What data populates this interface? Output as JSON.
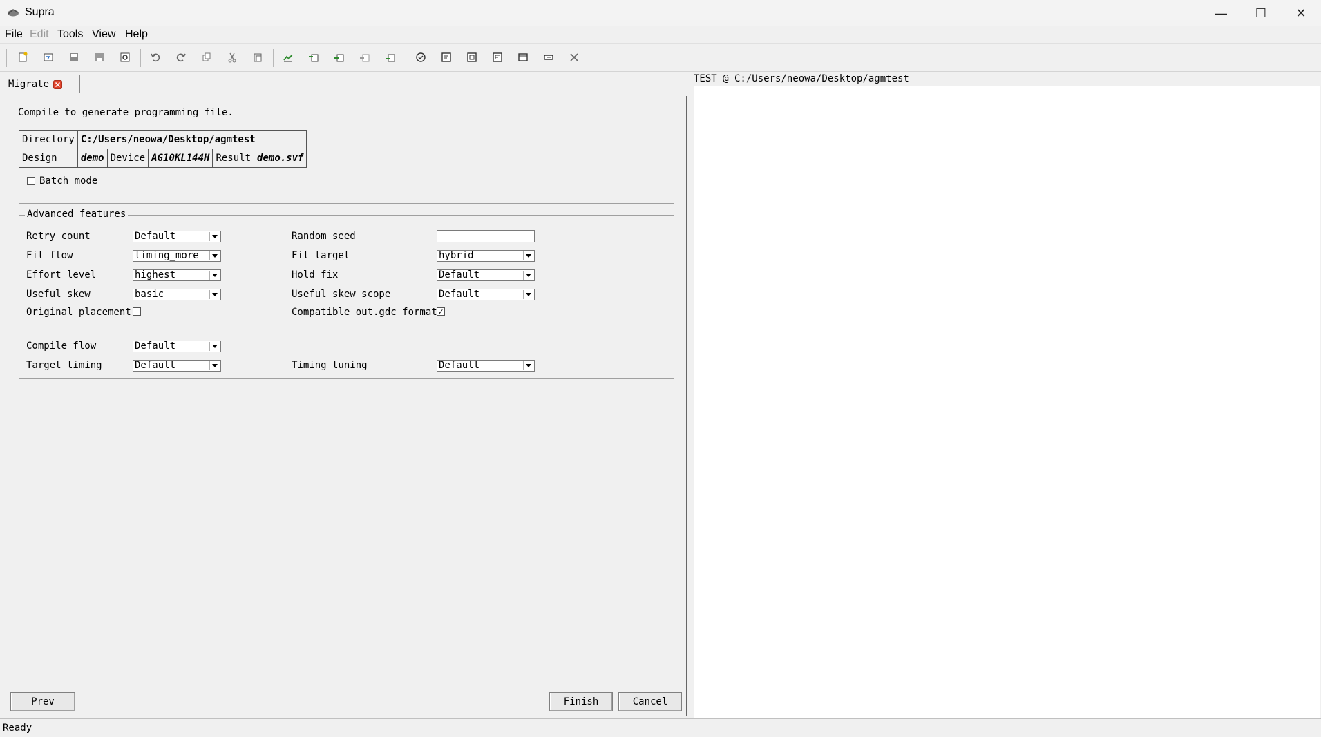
{
  "window": {
    "title": "Supra",
    "minimize": "—",
    "maximize": "☐",
    "close": "✕"
  },
  "menu": [
    "File",
    "Edit",
    "Tools",
    "View",
    "Help"
  ],
  "toolbar": {
    "icons": [
      "new-file",
      "open-file",
      "save",
      "save-as",
      "settings",
      "undo",
      "redo",
      "copy",
      "cut",
      "paste",
      "chart",
      "import-1",
      "import-2",
      "import-3",
      "import-4",
      "check",
      "panel-1",
      "panel-2",
      "panel-3",
      "panel-4",
      "panel-5",
      "close"
    ]
  },
  "tab": {
    "label": "Migrate"
  },
  "wizard": {
    "intro": "Compile to generate programming file.",
    "info": {
      "directory_label": "Directory",
      "directory_value": "C:/Users/neowa/Desktop/agmtest",
      "design_label": "Design",
      "design_value": "demo",
      "device_label": "Device",
      "device_value": "AG10KL144H",
      "result_label": "Result",
      "result_value": "demo.svf"
    },
    "batch_mode": {
      "label": "Batch mode",
      "checked": false
    },
    "advanced": {
      "title": "Advanced features",
      "retry_count": {
        "label": "Retry count",
        "value": "Default"
      },
      "random_seed": {
        "label": "Random seed",
        "value": ""
      },
      "fit_flow": {
        "label": "Fit flow",
        "value": "timing_more"
      },
      "fit_target": {
        "label": "Fit target",
        "value": "hybrid"
      },
      "effort_level": {
        "label": "Effort level",
        "value": "highest"
      },
      "hold_fix": {
        "label": "Hold fix",
        "value": "Default"
      },
      "useful_skew": {
        "label": "Useful skew",
        "value": "basic"
      },
      "useful_skew_scope": {
        "label": "Useful skew scope",
        "value": "Default"
      },
      "original_placement": {
        "label": "Original placement",
        "checked": false
      },
      "compatible_gdc": {
        "label": "Compatible out.gdc format",
        "checked": true
      },
      "compile_flow": {
        "label": "Compile flow",
        "value": "Default"
      },
      "target_timing": {
        "label": "Target timing",
        "value": "Default"
      },
      "timing_tuning": {
        "label": "Timing tuning",
        "value": "Default"
      }
    },
    "buttons": {
      "prev": "Prev",
      "finish": "Finish",
      "cancel": "Cancel"
    }
  },
  "right_panel": {
    "header": "TEST @ C:/Users/neowa/Desktop/agmtest"
  },
  "status": {
    "text": "Ready"
  },
  "colors": {
    "tab_close": "#e0442c",
    "check_green": "#2e8b2e"
  }
}
